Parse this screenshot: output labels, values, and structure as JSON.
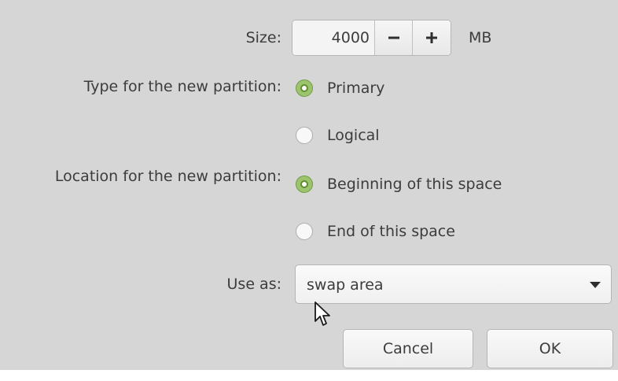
{
  "size": {
    "label": "Size:",
    "value": "4000",
    "decrement_icon": "minus-icon",
    "increment_icon": "plus-icon",
    "unit": "MB"
  },
  "type": {
    "label": "Type for the new partition:",
    "options": [
      {
        "label": "Primary",
        "checked": true
      },
      {
        "label": "Logical",
        "checked": false
      }
    ]
  },
  "location": {
    "label": "Location for the new partition:",
    "options": [
      {
        "label": "Beginning of this space",
        "checked": true
      },
      {
        "label": "End of this space",
        "checked": false
      }
    ]
  },
  "use_as": {
    "label": "Use as:",
    "selected": "swap area",
    "icon": "caret-down-icon"
  },
  "buttons": {
    "cancel": "Cancel",
    "ok": "OK"
  },
  "colors": {
    "dialog_bg": "#d6d6d6",
    "radio_accent": "#9dc36f",
    "text": "#3c3c3c"
  }
}
